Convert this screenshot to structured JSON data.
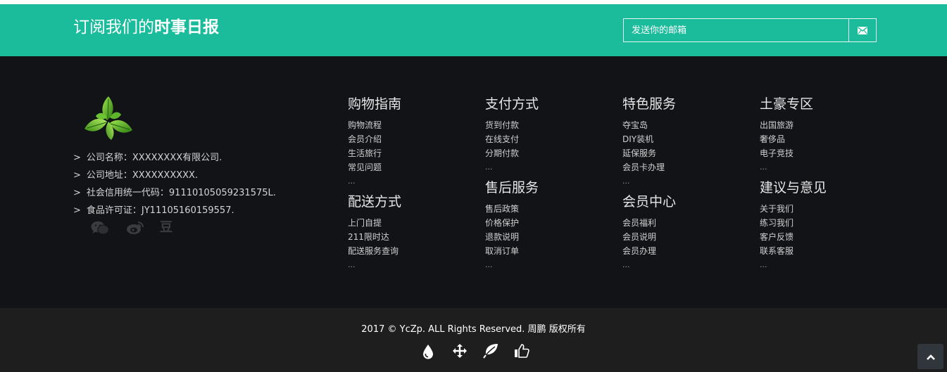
{
  "newsletter": {
    "title_prefix": "订阅我们的",
    "title_strong": "时事日报",
    "email_placeholder": "发送你的邮箱",
    "submit_icon": "envelope-icon"
  },
  "company": {
    "logo_icon": "green-leaf-logo",
    "info": [
      "公司名称：XXXXXXXX有限公司.",
      "公司地址：XXXXXXXXXX.",
      "社会信用统一代码：91110105059231575L.",
      "食品许可证：JY11105160159557."
    ],
    "socials": [
      "wechat-icon",
      "weibo-icon",
      "douban-icon"
    ],
    "douban_glyph": "豆",
    "bullet": ">"
  },
  "columns": [
    {
      "groups": [
        {
          "title": "购物指南",
          "links": [
            "购物流程",
            "会员介绍",
            "生活旅行",
            "常见问题"
          ],
          "more": "..."
        },
        {
          "title": "配送方式",
          "links": [
            "上门自提",
            "211限时达",
            "配送服务查询"
          ],
          "more": "..."
        }
      ]
    },
    {
      "groups": [
        {
          "title": "支付方式",
          "links": [
            "货到付款",
            "在线支付",
            "分期付款"
          ],
          "more": "..."
        },
        {
          "title": "售后服务",
          "links": [
            "售后政策",
            "价格保护",
            "退款说明",
            "取消订单"
          ],
          "more": "..."
        }
      ]
    },
    {
      "groups": [
        {
          "title": "特色服务",
          "links": [
            "夺宝岛",
            "DIY装机",
            "延保服务",
            "会员卡办理"
          ],
          "more": "..."
        },
        {
          "title": "会员中心",
          "links": [
            "会员福利",
            "会员说明",
            "会员办理"
          ],
          "more": "..."
        }
      ]
    },
    {
      "groups": [
        {
          "title": "土豪专区",
          "links": [
            "出国旅游",
            "奢侈品",
            "电子竞技"
          ],
          "more": "..."
        },
        {
          "title": "建议与意见",
          "links": [
            "关于我们",
            "练习我们",
            "客户反馈",
            "联系客服"
          ],
          "more": "..."
        }
      ]
    }
  ],
  "footer": {
    "copyright": "2017 © YcZp. ALL Rights Reserved. 周鹏 版权所有",
    "icons": [
      "water-drop-icon",
      "move-arrows-icon",
      "leaf-icon",
      "thumbs-up-icon"
    ],
    "back_to_top_icon": "chevron-up-icon"
  }
}
